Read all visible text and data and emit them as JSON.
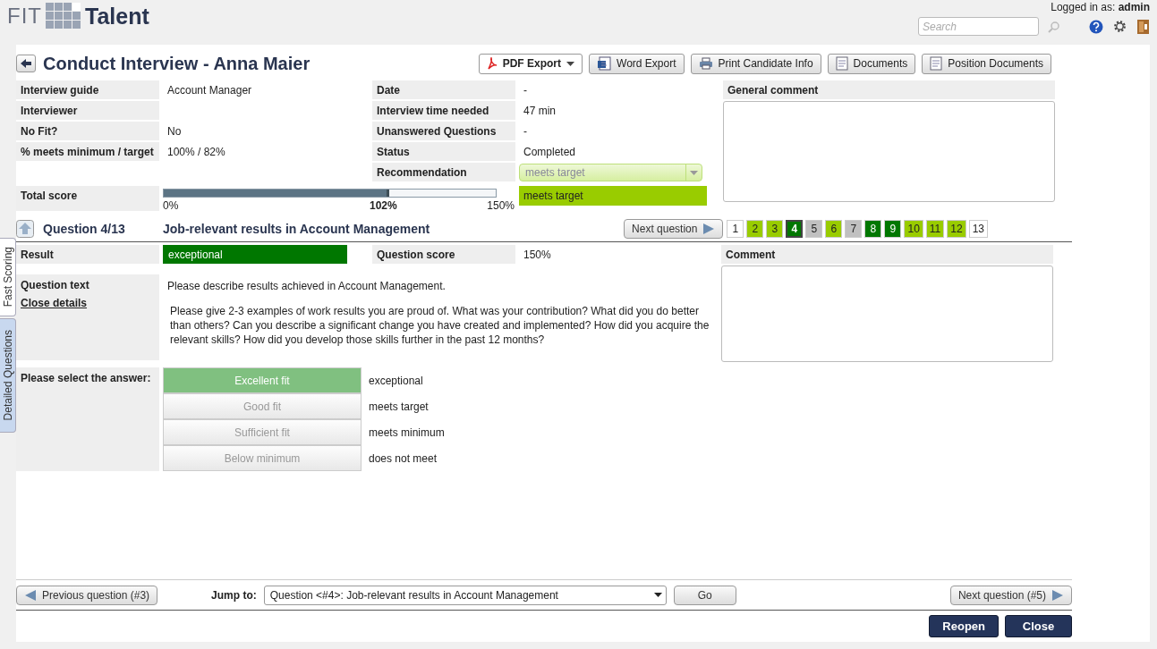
{
  "header": {
    "logo_left": "FIT",
    "logo_right": "Talent",
    "logged_in_label": "Logged in as:",
    "user": "admin",
    "search": {
      "placeholder": "Search"
    }
  },
  "side_tabs": [
    {
      "label": "Fast Scoring",
      "selected": true
    },
    {
      "label": "Detailed Questions",
      "selected": false
    }
  ],
  "title": "Conduct Interview - Anna Maier",
  "toolbar": [
    {
      "label": "PDF Export",
      "kind": "pdf"
    },
    {
      "label": "Word Export",
      "kind": "word"
    },
    {
      "label": "Print Candidate Info",
      "kind": "print"
    },
    {
      "label": "Documents",
      "kind": "document"
    },
    {
      "label": "Position Documents",
      "kind": "document"
    }
  ],
  "info_rows": [
    {
      "label": "Interview guide",
      "value": "Account Manager",
      "label_2": "Date",
      "value_2": "-"
    },
    {
      "label": "Interviewer",
      "label_2": "Interview time needed",
      "value_2": "47 min"
    },
    {
      "label": "No Fit?",
      "value": "No",
      "label_2": "Unanswered Questions",
      "value_2": "-"
    },
    {
      "label": "% meets minimum / target",
      "value": "100% / 82%",
      "label_2": "Status",
      "value_2": "Completed"
    }
  ],
  "recommendation": {
    "label": "Recommendation",
    "value": "meets target"
  },
  "general_comment": {
    "label": "General comment"
  },
  "total_score": {
    "label": "Total score",
    "level": 0.68,
    "min_label": "0%",
    "value_label": "102%",
    "max_label": "150%",
    "result": "meets target"
  },
  "question": {
    "counter": "Question 4/13",
    "title": "Job-relevant results in Account Management",
    "next_button": "Next question",
    "numbers": [
      {
        "label": "1",
        "color": "#ffffff",
        "selected": false
      },
      {
        "label": "2",
        "color": "#99cc00",
        "selected": false
      },
      {
        "label": "3",
        "color": "#99cc00",
        "selected": false
      },
      {
        "label": "4",
        "color": "#007700",
        "selected": true
      },
      {
        "label": "5",
        "color": "#c0c0c0",
        "selected": false
      },
      {
        "label": "6",
        "color": "#99cc00",
        "selected": false
      },
      {
        "label": "7",
        "color": "#c0c0c0",
        "selected": false
      },
      {
        "label": "8",
        "color": "#007700",
        "selected": false
      },
      {
        "label": "9",
        "color": "#007700",
        "selected": false
      },
      {
        "label": "10",
        "color": "#99cc00",
        "selected": false
      },
      {
        "label": "11",
        "color": "#99cc00",
        "selected": false
      },
      {
        "label": "12",
        "color": "#99cc00",
        "selected": false
      },
      {
        "label": "13",
        "color": "#ffffff",
        "selected": false
      }
    ]
  },
  "result": {
    "label": "Result",
    "value": "exceptional",
    "score_label": "Question score",
    "score_value": "150%"
  },
  "comment": {
    "label": "Comment"
  },
  "question_text": {
    "label": "Question text",
    "link": "Close details",
    "lead": "Please describe results achieved in Account Management.",
    "body": "Please give 2-3 examples of work results you are proud of. What was your contribution? What did you do better than others? Can you describe a significant change you have created and implemented? How did you acquire the relevant skills? How did you develop those skills further in the past 12 months?"
  },
  "answers": {
    "label": "Please select the answer:",
    "options": [
      {
        "label": "Excellent fit",
        "meaning": "exceptional",
        "selected": true
      },
      {
        "label": "Good fit",
        "meaning": "meets target",
        "selected": false
      },
      {
        "label": "Sufficient fit",
        "meaning": "meets minimum",
        "selected": false
      },
      {
        "label": "Below minimum",
        "meaning": "does not meet",
        "selected": false
      }
    ]
  },
  "footer": {
    "previous": "Previous question (#3)",
    "jump_label": "Jump to:",
    "jump_value": "Question <#4>: Job-relevant results in Account Management",
    "go": "Go",
    "next": "Next question (#5)"
  },
  "actions": [
    "Reopen",
    "Close"
  ]
}
